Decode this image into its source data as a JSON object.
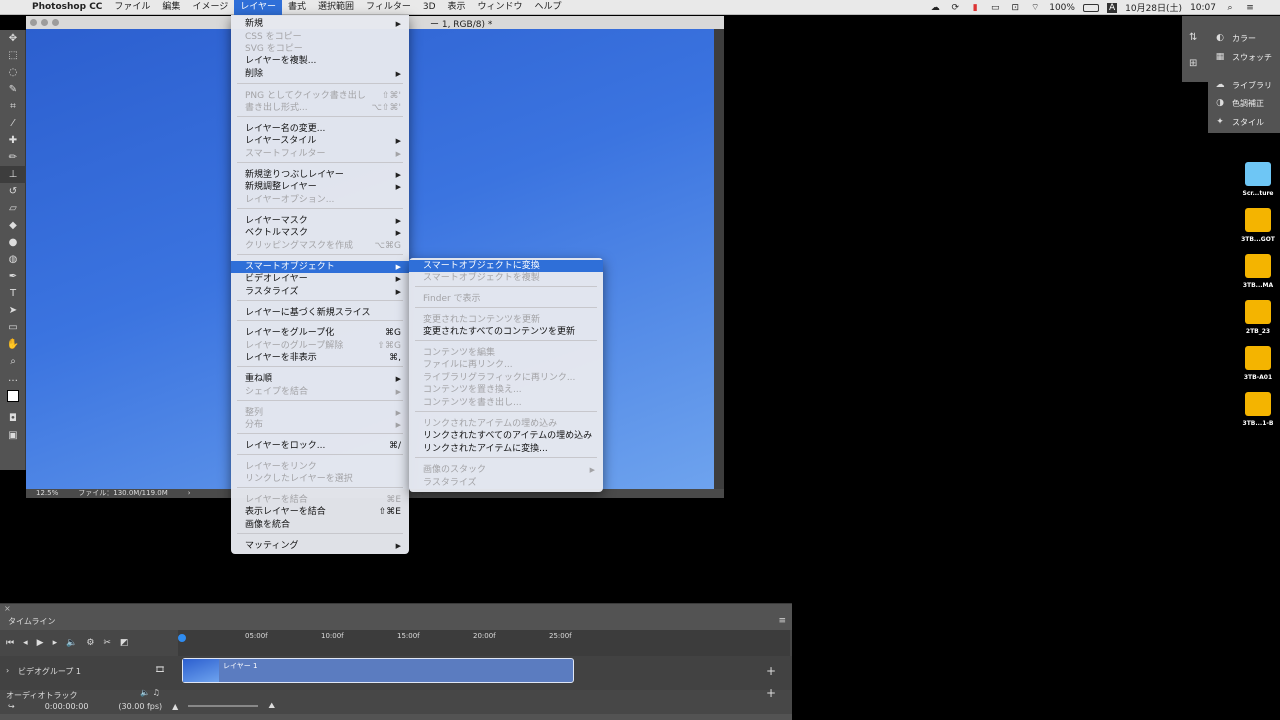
{
  "menubar": {
    "app": "Photoshop CC",
    "items": [
      "ファイル",
      "編集",
      "イメージ",
      "レイヤー",
      "書式",
      "選択範囲",
      "フィルター",
      "3D",
      "表示",
      "ウィンドウ",
      "ヘルプ"
    ],
    "active_index": 3,
    "status": {
      "battery": "100%",
      "input": "A",
      "datetime": "10月28日(土)",
      "time": "10:07"
    }
  },
  "document": {
    "title": "ー 1, RGB/8) *",
    "zoom": "12.5%",
    "file_info": "ファイル：130.0M/119.0M",
    "arrow": "›"
  },
  "layer_menu": {
    "items": [
      {
        "label": "新規",
        "arrow": "▶"
      },
      {
        "label": "CSS をコピー",
        "disabled": true
      },
      {
        "label": "SVG をコピー",
        "disabled": true
      },
      {
        "label": "レイヤーを複製..."
      },
      {
        "label": "削除",
        "arrow": "▶"
      },
      {
        "label": "PNG としてクイック書き出し",
        "shortcut": "⇧⌘'",
        "disabled": true
      },
      {
        "label": "書き出し形式...",
        "shortcut": "⌥⇧⌘'",
        "disabled": true
      },
      {
        "label": "レイヤー名の変更..."
      },
      {
        "label": "レイヤースタイル",
        "arrow": "▶"
      },
      {
        "label": "スマートフィルター",
        "arrow": "▶",
        "disabled": true
      },
      {
        "label": "新規塗りつぶしレイヤー",
        "arrow": "▶"
      },
      {
        "label": "新規調整レイヤー",
        "arrow": "▶"
      },
      {
        "label": "レイヤーオプション...",
        "disabled": true
      },
      {
        "label": "レイヤーマスク",
        "arrow": "▶"
      },
      {
        "label": "ベクトルマスク",
        "arrow": "▶"
      },
      {
        "label": "クリッピングマスクを作成",
        "shortcut": "⌥⌘G",
        "disabled": true
      },
      {
        "label": "スマートオブジェクト",
        "arrow": "▶",
        "highlighted": true
      },
      {
        "label": "ビデオレイヤー",
        "arrow": "▶"
      },
      {
        "label": "ラスタライズ",
        "arrow": "▶"
      },
      {
        "label": "レイヤーに基づく新規スライス"
      },
      {
        "label": "レイヤーをグループ化",
        "shortcut": "⌘G"
      },
      {
        "label": "レイヤーのグループ解除",
        "shortcut": "⇧⌘G",
        "disabled": true
      },
      {
        "label": "レイヤーを非表示",
        "shortcut": "⌘,"
      },
      {
        "label": "重ね順",
        "arrow": "▶"
      },
      {
        "label": "シェイプを結合",
        "arrow": "▶",
        "disabled": true
      },
      {
        "label": "整列",
        "arrow": "▶",
        "disabled": true
      },
      {
        "label": "分布",
        "arrow": "▶",
        "disabled": true
      },
      {
        "label": "レイヤーをロック...",
        "shortcut": "⌘/"
      },
      {
        "label": "レイヤーをリンク",
        "disabled": true
      },
      {
        "label": "リンクしたレイヤーを選択",
        "disabled": true
      },
      {
        "label": "レイヤーを結合",
        "shortcut": "⌘E",
        "disabled": true
      },
      {
        "label": "表示レイヤーを結合",
        "shortcut": "⇧⌘E"
      },
      {
        "label": "画像を統合"
      },
      {
        "label": "マッティング",
        "arrow": "▶"
      }
    ]
  },
  "smart_submenu": {
    "items": [
      {
        "label": "スマートオブジェクトに変換",
        "highlighted": true
      },
      {
        "label": "スマートオブジェクトを複製",
        "disabled": true
      },
      {
        "label": "Finder で表示",
        "disabled": true
      },
      {
        "label": "変更されたコンテンツを更新",
        "disabled": true
      },
      {
        "label": "変更されたすべてのコンテンツを更新"
      },
      {
        "label": "コンテンツを編集",
        "disabled": true
      },
      {
        "label": "ファイルに再リンク...",
        "disabled": true
      },
      {
        "label": "ライブラリグラフィックに再リンク...",
        "disabled": true
      },
      {
        "label": "コンテンツを置き換え...",
        "disabled": true
      },
      {
        "label": "コンテンツを書き出し...",
        "disabled": true
      },
      {
        "label": "リンクされたアイテムの埋め込み",
        "disabled": true
      },
      {
        "label": "リンクされたすべてのアイテムの埋め込み"
      },
      {
        "label": "リンクされたアイテムに変換..."
      },
      {
        "label": "画像のスタック",
        "arrow": "▶",
        "disabled": true
      },
      {
        "label": "ラスタライズ",
        "disabled": true
      }
    ]
  },
  "right_panel": {
    "items": [
      {
        "label": "カラー",
        "icon": "color-icon",
        "glyph": "◐"
      },
      {
        "label": "スウォッチ",
        "icon": "swatches-icon",
        "glyph": "▦"
      },
      {
        "label": "ライブラリ",
        "icon": "libraries-icon",
        "glyph": "☁"
      },
      {
        "label": "色調補正",
        "icon": "adjustments-icon",
        "glyph": "◑"
      },
      {
        "label": "スタイル",
        "icon": "styles-icon",
        "glyph": "✦"
      }
    ]
  },
  "desktop": {
    "icons": [
      {
        "label": "Scr...ture",
        "kind": "folder",
        "color": "#6ec6f5"
      },
      {
        "label": "3TB...GOT",
        "kind": "drive",
        "color": "#f4b400"
      },
      {
        "label": "3TB...MA",
        "kind": "drive",
        "color": "#f4b400"
      },
      {
        "label": "2TB_23",
        "kind": "drive",
        "color": "#f4b400"
      },
      {
        "label": "3TB-A01",
        "kind": "drive",
        "color": "#f4b400"
      },
      {
        "label": "3TB...1-B",
        "kind": "drive",
        "color": "#f4b400"
      }
    ]
  },
  "timeline": {
    "tab": "タイムライン",
    "ticks": [
      "05:00f",
      "10:00f",
      "15:00f",
      "20:00f",
      "25:00f"
    ],
    "video_group": "ビデオグループ 1",
    "audio_track": "オーディオトラック",
    "clip_label": "レイヤー 1",
    "timecode": "0:00:00:00",
    "fps": "(30.00 fps)",
    "add": "+"
  },
  "colors": {
    "accent": "#2f6fd8",
    "menubar": "#e9e9e9",
    "panel": "#535353"
  }
}
